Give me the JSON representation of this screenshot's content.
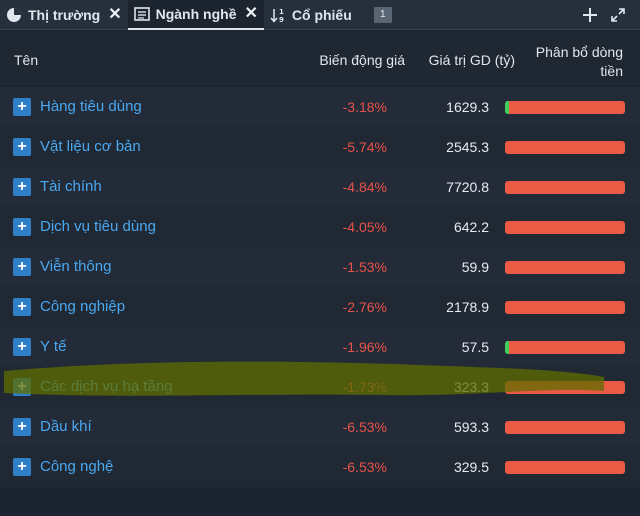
{
  "tabs": [
    {
      "label": "Thị trường",
      "icon": "pie-chart-icon",
      "closable": true,
      "active": false
    },
    {
      "label": "Ngành nghề",
      "icon": "list-icon",
      "closable": true,
      "active": true
    },
    {
      "label": "Cổ phiếu",
      "icon": "sort-numeric-icon",
      "closable": false,
      "active": false,
      "badge": "1"
    }
  ],
  "table": {
    "headers": {
      "name": "Tên",
      "change": "Biến động giá",
      "value": "Giá trị GD (tỷ)",
      "flow": "Phân bổ dòng tiền"
    },
    "rows": [
      {
        "name": "Hàng tiêu dùng",
        "change": "-3.18%",
        "value": "1629.3",
        "inflow_fraction": 0.03
      },
      {
        "name": "Vật liệu cơ bản",
        "change": "-5.74%",
        "value": "2545.3",
        "inflow_fraction": 0.0
      },
      {
        "name": "Tài chính",
        "change": "-4.84%",
        "value": "7720.8",
        "inflow_fraction": 0.0
      },
      {
        "name": "Dịch vụ tiêu dùng",
        "change": "-4.05%",
        "value": "642.2",
        "inflow_fraction": 0.0
      },
      {
        "name": "Viễn thông",
        "change": "-1.53%",
        "value": "59.9",
        "inflow_fraction": 0.0
      },
      {
        "name": "Công nghiệp",
        "change": "-2.76%",
        "value": "2178.9",
        "inflow_fraction": 0.0
      },
      {
        "name": "Y tế",
        "change": "-1.96%",
        "value": "57.5",
        "inflow_fraction": 0.03
      },
      {
        "name": "Các dịch vụ hạ tầng",
        "change": "-1.73%",
        "value": "323.3",
        "inflow_fraction": 0.0
      },
      {
        "name": "Dầu khí",
        "change": "-6.53%",
        "value": "593.3",
        "inflow_fraction": 0.0
      },
      {
        "name": "Công nghệ",
        "change": "-6.53%",
        "value": "329.5",
        "inflow_fraction": 0.0
      }
    ]
  },
  "colors": {
    "negative": "#e8534a",
    "inflow": "#3ecf5a",
    "outflow": "#ea5a44",
    "link": "#4aa8f0",
    "highlight": "#6b7a00"
  }
}
